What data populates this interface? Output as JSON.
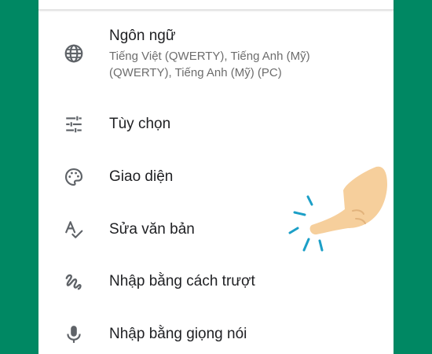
{
  "settings": {
    "items": [
      {
        "icon": "globe-icon",
        "title": "Ngôn ngữ",
        "subtitle": "Tiếng Việt (QWERTY), Tiếng Anh (Mỹ) (QWERTY), Tiếng Anh (Mỹ) (PC)"
      },
      {
        "icon": "sliders-icon",
        "title": "Tùy chọn"
      },
      {
        "icon": "palette-icon",
        "title": "Giao diện"
      },
      {
        "icon": "spellcheck-icon",
        "title": "Sửa văn bản"
      },
      {
        "icon": "gesture-icon",
        "title": "Nhập bằng cách trượt"
      },
      {
        "icon": "microphone-icon",
        "title": "Nhập bằng giọng nói"
      }
    ]
  },
  "overlay": {
    "icon": "tapping-hand-icon",
    "target": "Sửa văn bản"
  },
  "colors": {
    "background": "#008863",
    "panel": "#ffffff",
    "icon": "#5f6368",
    "title": "#202124",
    "subtitle": "#6d6d6d",
    "hand": "#f6cf9c",
    "tap_ripple": "#1c9fc7"
  }
}
